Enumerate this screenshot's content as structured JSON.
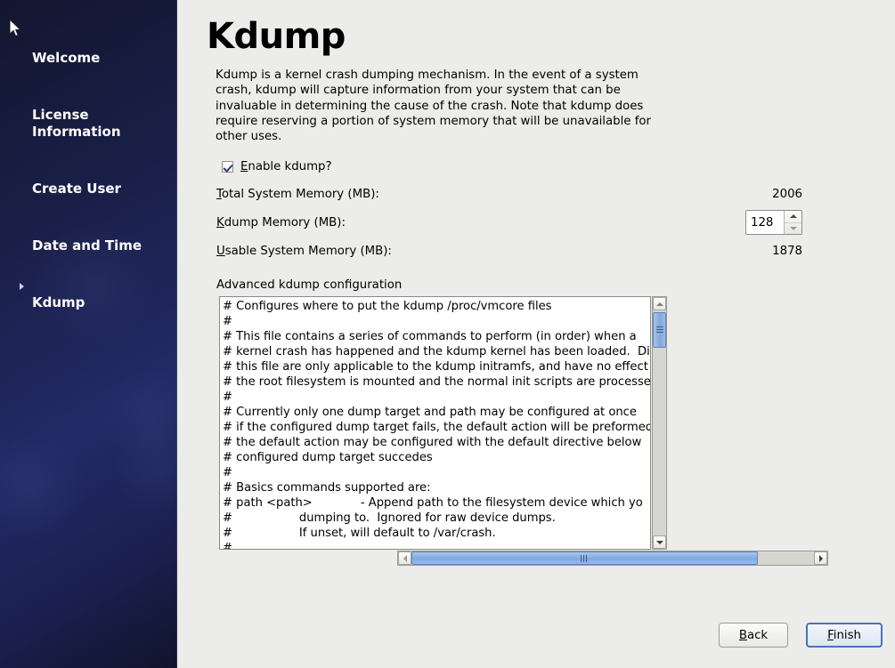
{
  "sidebar": {
    "items": [
      {
        "label": "Welcome",
        "current": false
      },
      {
        "label": "License\nInformation",
        "current": false
      },
      {
        "label": "Create User",
        "current": false
      },
      {
        "label": "Date and Time",
        "current": false
      },
      {
        "label": "Kdump",
        "current": true
      }
    ]
  },
  "page": {
    "title": "Kdump",
    "intro": "Kdump is a kernel crash dumping mechanism. In the event of a system crash, kdump will capture information from your system that can be invaluable in determining the cause of the crash. Note that kdump does require reserving a portion of system memory that will be unavailable for other uses."
  },
  "form": {
    "enable_checkbox": {
      "mnemonic": "E",
      "rest": "nable kdump?",
      "checked": true
    },
    "total_memory": {
      "mnemonic": "T",
      "rest": "otal System Memory (MB):",
      "value": "2006"
    },
    "kdump_memory": {
      "mnemonic": "K",
      "rest": "dump Memory (MB):",
      "value": "128"
    },
    "usable_memory": {
      "mnemonic": "U",
      "rest": "sable System Memory (MB):",
      "value": "1878"
    },
    "advanced_label": "Advanced kdump configuration",
    "advanced_text": "# Configures where to put the kdump /proc/vmcore files\n#\n# This file contains a series of commands to perform (in order) when a\n# kernel crash has happened and the kdump kernel has been loaded.  Di\n# this file are only applicable to the kdump initramfs, and have no effect\n# the root filesystem is mounted and the normal init scripts are processe\n#\n# Currently only one dump target and path may be configured at once\n# if the configured dump target fails, the default action will be preformed\n# the default action may be configured with the default directive below\n# configured dump target succedes\n#\n# Basics commands supported are:\n# path <path>             - Append path to the filesystem device which yo\n#                  dumping to.  Ignored for raw device dumps.\n#                  If unset, will default to /var/crash.\n#"
  },
  "buttons": {
    "back": {
      "mnemonic": "B",
      "rest": "ack"
    },
    "finish": {
      "mnemonic": "F",
      "rest": "inish"
    }
  },
  "colors": {
    "sidebar_dark": "#13162f",
    "sidebar_mid": "#232a66",
    "content_bg": "#ececea",
    "scroll_thumb": "#81a9df",
    "focus_border": "#4a74b5"
  }
}
